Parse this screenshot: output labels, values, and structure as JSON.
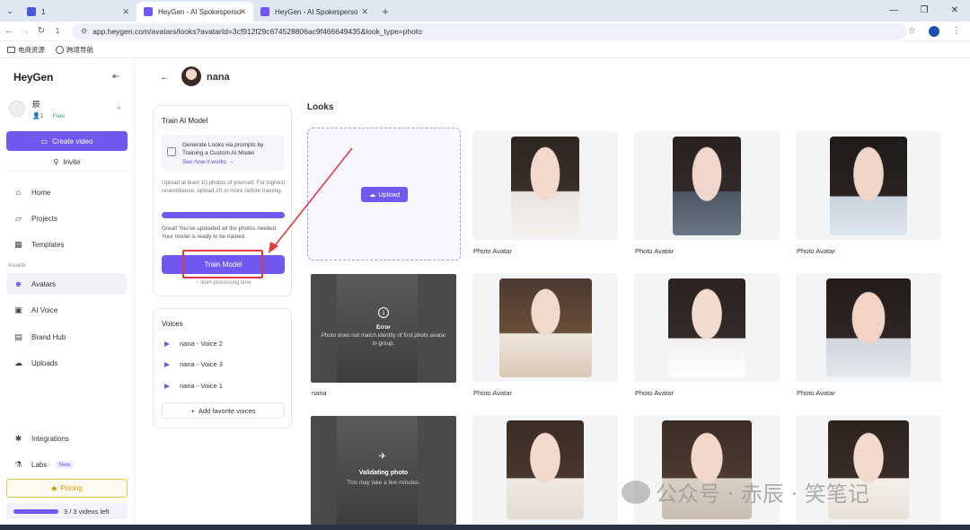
{
  "browser": {
    "tabs": [
      {
        "label": "1",
        "active": false
      },
      {
        "label": "HeyGen - AI Spokesperson V",
        "active": true
      },
      {
        "label": "HeyGen - AI Spokesperson V",
        "active": false
      }
    ],
    "url": "app.heygen.com/avatars/looks?avatarId=3cf912f29c674528806ac9f466649435&look_type=photo",
    "bookmarks": [
      "电商资源",
      "跨境导航"
    ]
  },
  "sidebar": {
    "logo": "HeyGen",
    "workspace": {
      "name": "辰",
      "members": "1",
      "plan": "Free"
    },
    "create_label": "Create video",
    "invite_label": "Invite",
    "nav": [
      {
        "label": "Home",
        "icon": "home-icon"
      },
      {
        "label": "Projects",
        "icon": "folder-icon"
      },
      {
        "label": "Templates",
        "icon": "template-icon"
      }
    ],
    "assets_label": "Assets",
    "assets_nav": [
      {
        "label": "Avatars",
        "icon": "avatar-icon",
        "active": true
      },
      {
        "label": "AI Voice",
        "icon": "voice-icon"
      },
      {
        "label": "Brand Hub",
        "icon": "brand-icon"
      },
      {
        "label": "Uploads",
        "icon": "upload-icon"
      }
    ],
    "integrations_label": "Integrations",
    "labs_label": "Labs",
    "labs_badge": "New",
    "pricing_label": "Pricing",
    "quota_text": "3 / 3 videos left",
    "quota_fraction": 1.0
  },
  "header": {
    "name": "nana"
  },
  "train": {
    "title": "Train AI Model",
    "info_text": "Generate Looks via prompts by Training a Custom AI Model",
    "info_link": "See how it works →",
    "desc": "Upload at least 10 photos of yourself. For highest resemblance, upload 20 or more before training.",
    "progress_fraction": 1.0,
    "ok_text": "Great! You've uploaded all the photos needed. Your model is ready to be trained.",
    "button_label": "Train Model",
    "time_note": "~ 3min processing time"
  },
  "voices": {
    "title": "Voices",
    "items": [
      "nana - Voice 2",
      "nana - Voice 3",
      "nana - Voice 1"
    ],
    "add_label": "Add favorite voices"
  },
  "looks": {
    "title": "Looks",
    "upload_label": "Upload",
    "photo_label": "Photo Avatar",
    "error_title": "Error",
    "error_msg": "Photo does not match identity of first photo avatar in group.",
    "error_tile_label": "nana",
    "validating_title": "Validating photo",
    "validating_msg": "This may take a few minutes."
  },
  "watermark": "公众号 · 赤辰 · 笑笔记",
  "colors": {
    "accent": "#7257f0",
    "annotation": "#e23b3b",
    "pricing": "#f5c24a"
  }
}
